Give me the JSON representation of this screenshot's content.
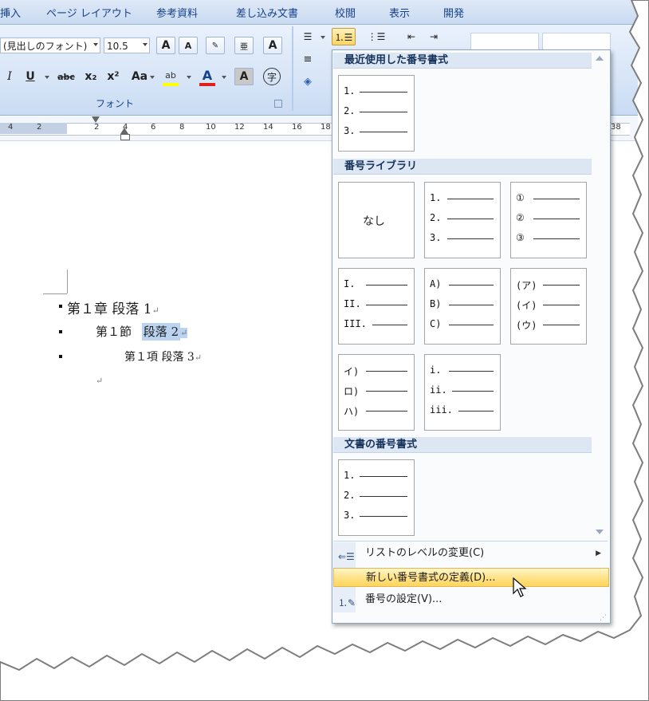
{
  "ribbon": {
    "tabs": [
      "挿入",
      "ページ レイアウト",
      "参考資料",
      "差し込み文書",
      "校閲",
      "表示",
      "開発"
    ],
    "font_name": "(見出しのフォント)",
    "font_size": "10.5",
    "group_label": "フォント",
    "btn_grow": "A",
    "btn_shrink": "A",
    "btn_italic": "I",
    "btn_underline": "U",
    "btn_strike": "abc",
    "btn_subscript": "x₂",
    "btn_superscript": "x²",
    "btn_case": "Aa",
    "btn_font_color": "A",
    "btn_char_shade": "A",
    "btn_enclose": "字",
    "btn_border_a": "A",
    "btn_phonetic": "亜"
  },
  "ruler": {
    "labels": [
      "4",
      "2",
      "2",
      "4",
      "6",
      "8",
      "10",
      "12",
      "14",
      "16",
      "18",
      "38"
    ]
  },
  "document": {
    "line1": "第１章  段落 1",
    "line2_a": "第１節",
    "line2_b": "段落 2",
    "line3": "第１項   段落 3",
    "para_mark": "↵"
  },
  "gallery": {
    "section_recent": "最近使用した番号書式",
    "section_library": "番号ライブラリ",
    "section_document": "文書の番号書式",
    "none_label": "なし",
    "recent_tile": [
      "1.",
      "2.",
      "3."
    ],
    "library_tiles": [
      [
        "1.",
        "2.",
        "3."
      ],
      [
        "①",
        "②",
        "③"
      ],
      [
        "I.",
        "II.",
        "III."
      ],
      [
        "A)",
        "B)",
        "C)"
      ],
      [
        "(ア)",
        "(イ)",
        "(ウ)"
      ],
      [
        "イ)",
        "ロ)",
        "ハ)"
      ],
      [
        "i.",
        "ii.",
        "iii."
      ]
    ],
    "document_tile": [
      "1.",
      "2.",
      "3."
    ]
  },
  "menu": {
    "change_level": "リストのレベルの変更(C)",
    "define_new": "新しい番号書式の定義(D)...",
    "set_value": "番号の設定(V)..."
  },
  "colors": {
    "ribbon_bg": "#d7e5f7",
    "highlight": "#ffe38a",
    "section_header": "#dde7f3",
    "text_highlight": "#b9d3f0",
    "font_color_bar": "#e02020",
    "highlighter_bar": "#ffff00"
  },
  "icons": [
    "bullets-icon",
    "numbering-icon",
    "multilevel-list-icon",
    "decrease-indent-icon",
    "increase-indent-icon",
    "align-left-icon",
    "shading-icon",
    "submenu-arrow-icon",
    "mouse-pointer-icon",
    "resize-grip-icon"
  ]
}
